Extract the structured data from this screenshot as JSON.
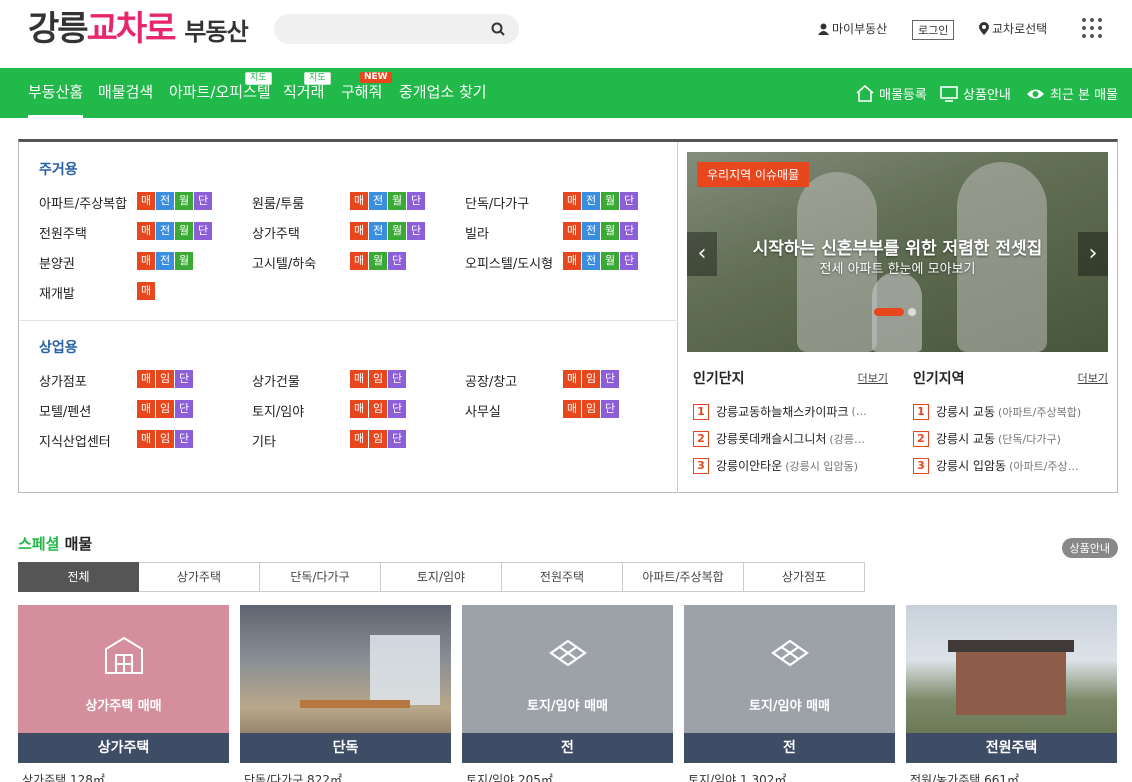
{
  "header": {
    "logo_part1": "강릉",
    "logo_part2": "교차로",
    "logo_part3": "부동산",
    "search_placeholder": "",
    "my_page": "마이부동산",
    "login": "로그인",
    "route_select": "교차로선택"
  },
  "nav": {
    "items": [
      {
        "label": "부동산홈",
        "badge": ""
      },
      {
        "label": "매물검색",
        "badge": ""
      },
      {
        "label": "아파트/오피스텔",
        "badge": "지도"
      },
      {
        "label": "직거래",
        "badge": "지도"
      },
      {
        "label": "구해줘",
        "badge": "NEW"
      },
      {
        "label": "중개업소 찾기",
        "badge": ""
      }
    ],
    "right": {
      "register": "매물등록",
      "product": "상품안내",
      "recent": "최근 본 매물"
    }
  },
  "residential": {
    "title": "주거용",
    "cats": [
      {
        "label": "아파트/주상복합",
        "tags": [
          "매",
          "전",
          "월",
          "단"
        ]
      },
      {
        "label": "원룸/투룸",
        "tags": [
          "매",
          "전",
          "월",
          "단"
        ]
      },
      {
        "label": "단독/다가구",
        "tags": [
          "매",
          "전",
          "월",
          "단"
        ]
      },
      {
        "label": "전원주택",
        "tags": [
          "매",
          "전",
          "월",
          "단"
        ]
      },
      {
        "label": "상가주택",
        "tags": [
          "매",
          "전",
          "월",
          "단"
        ]
      },
      {
        "label": "빌라",
        "tags": [
          "매",
          "전",
          "월",
          "단"
        ]
      },
      {
        "label": "분양권",
        "tags": [
          "매",
          "전",
          "월"
        ]
      },
      {
        "label": "고시텔/하숙",
        "tags": [
          "매",
          "월",
          "단"
        ]
      },
      {
        "label": "오피스텔/도시형",
        "tags": [
          "매",
          "전",
          "월",
          "단"
        ]
      },
      {
        "label": "재개발",
        "tags": [
          "매"
        ]
      }
    ]
  },
  "commercial": {
    "title": "상업용",
    "cats": [
      {
        "label": "상가점포",
        "tags": [
          "매",
          "임",
          "단"
        ]
      },
      {
        "label": "상가건물",
        "tags": [
          "매",
          "임",
          "단"
        ]
      },
      {
        "label": "공장/창고",
        "tags": [
          "매",
          "임",
          "단"
        ]
      },
      {
        "label": "모텔/펜션",
        "tags": [
          "매",
          "임",
          "단"
        ]
      },
      {
        "label": "토지/임야",
        "tags": [
          "매",
          "임",
          "단"
        ]
      },
      {
        "label": "사무실",
        "tags": [
          "매",
          "임",
          "단"
        ]
      },
      {
        "label": "지식산업센터",
        "tags": [
          "매",
          "임",
          "단"
        ]
      },
      {
        "label": "기타",
        "tags": [
          "매",
          "임",
          "단"
        ]
      }
    ]
  },
  "banner": {
    "tag": "우리지역 이슈매물",
    "headline": "시작하는 신혼부부를 위한 저렴한 전셋집",
    "subline": "전세 아파트 한눈에 모아보기"
  },
  "popular_complex": {
    "title": "인기단지",
    "more": "더보기",
    "items": [
      {
        "num": "1",
        "name": "강릉교동하늘채스카이파크",
        "sub": "(…"
      },
      {
        "num": "2",
        "name": "강릉롯데캐슬시그니처",
        "sub": "(강릉…"
      },
      {
        "num": "3",
        "name": "강릉이안타운",
        "sub": "(강릉시 입암동)"
      }
    ]
  },
  "popular_area": {
    "title": "인기지역",
    "more": "더보기",
    "items": [
      {
        "num": "1",
        "name": "강릉시 교동",
        "sub": "(아파트/주상복합)"
      },
      {
        "num": "2",
        "name": "강릉시 교동",
        "sub": "(단독/다가구)"
      },
      {
        "num": "3",
        "name": "강릉시 입암동",
        "sub": "(아파트/주상…"
      }
    ]
  },
  "special": {
    "title_green": "스페셜",
    "title_rest": " 매물",
    "guide": "상품안내",
    "tabs": [
      "전체",
      "상가주택",
      "단독/다가구",
      "토지/임야",
      "전원주택",
      "아파트/주상복합",
      "상가점포"
    ],
    "cards": [
      {
        "overlay": "상가주택 매매",
        "bar": "상가주택",
        "caption": "상가주택 128㎡"
      },
      {
        "overlay": "",
        "bar": "단독",
        "caption": "단독/다가구 822㎡"
      },
      {
        "overlay": "토지/임야 매매",
        "bar": "전",
        "caption": "토지/임야 205㎡"
      },
      {
        "overlay": "토지/임야 매매",
        "bar": "전",
        "caption": "토지/임야 1,302㎡"
      },
      {
        "overlay": "",
        "bar": "전원주택",
        "caption": "전원/농가주택 661㎡"
      }
    ]
  },
  "colors": {
    "brand_green": "#21b94a",
    "brand_pink": "#e8266d",
    "accent_orange": "#e8461d"
  }
}
